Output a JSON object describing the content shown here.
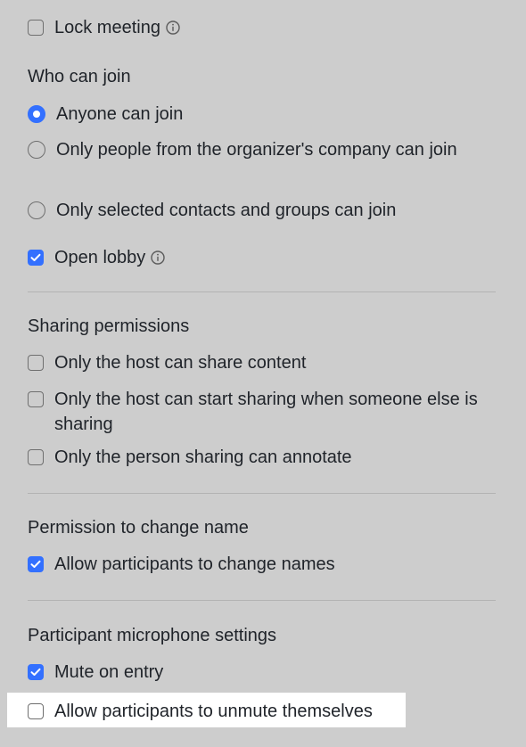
{
  "meeting": {
    "lock_meeting": {
      "label": "Lock meeting",
      "checked": false,
      "info_icon": "info-icon"
    }
  },
  "who_can_join": {
    "heading": "Who can join",
    "options": [
      {
        "label": "Anyone can join",
        "selected": true
      },
      {
        "label": "Only people from the organizer's company can join",
        "selected": false
      },
      {
        "label": "Only selected contacts and groups can join",
        "selected": false
      }
    ],
    "open_lobby": {
      "label": "Open lobby",
      "checked": true,
      "info_icon": "info-icon"
    }
  },
  "sharing_permissions": {
    "heading": "Sharing permissions",
    "options": [
      {
        "label": "Only the host can share content",
        "checked": false
      },
      {
        "label": "Only the host can start sharing when someone else is sharing",
        "checked": false
      },
      {
        "label": "Only the person sharing can annotate",
        "checked": false
      }
    ]
  },
  "change_name": {
    "heading": "Permission to change name",
    "options": [
      {
        "label": "Allow participants to change names",
        "checked": true
      }
    ]
  },
  "microphone": {
    "heading": "Participant microphone settings",
    "options": [
      {
        "label": "Mute on entry",
        "checked": true
      },
      {
        "label": "Allow participants to unmute themselves",
        "checked": false,
        "highlighted": true
      }
    ]
  },
  "colors": {
    "accent": "#3370ff",
    "background": "#cdcdcd",
    "highlight": "#ffffff"
  }
}
